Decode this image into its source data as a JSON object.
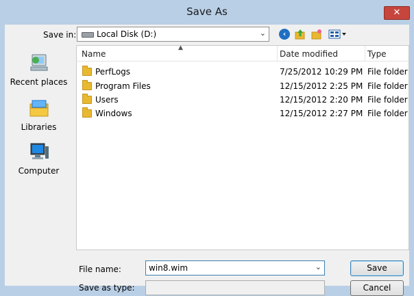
{
  "window": {
    "title": "Save As",
    "close_glyph": "✕"
  },
  "toolbar": {
    "save_in_label": "Save in:",
    "save_in_value": "Local Disk (D:)",
    "icons": [
      "back-icon",
      "up-folder-icon",
      "new-folder-icon",
      "views-menu-icon"
    ]
  },
  "places": [
    {
      "label": "Recent places",
      "icon": "recent-places-icon"
    },
    {
      "label": "Libraries",
      "icon": "libraries-icon"
    },
    {
      "label": "Computer",
      "icon": "computer-icon"
    }
  ],
  "columns": {
    "name": "Name",
    "date": "Date modified",
    "type": "Type"
  },
  "files": [
    {
      "name": "PerfLogs",
      "date": "7/25/2012 10:29 PM",
      "type": "File folder"
    },
    {
      "name": "Program Files",
      "date": "12/15/2012 2:25 PM",
      "type": "File folder"
    },
    {
      "name": "Users",
      "date": "12/15/2012 2:20 PM",
      "type": "File folder"
    },
    {
      "name": "Windows",
      "date": "12/15/2012 2:27 PM",
      "type": "File folder"
    }
  ],
  "form": {
    "file_name_label": "File name:",
    "file_name_value": "win8.wim",
    "save_type_label": "Save as type:",
    "save_label": "Save",
    "cancel_label": "Cancel"
  },
  "colors": {
    "title_bar": "#b9cfe6",
    "close_button": "#c6463d",
    "folder": "#e8b830"
  }
}
